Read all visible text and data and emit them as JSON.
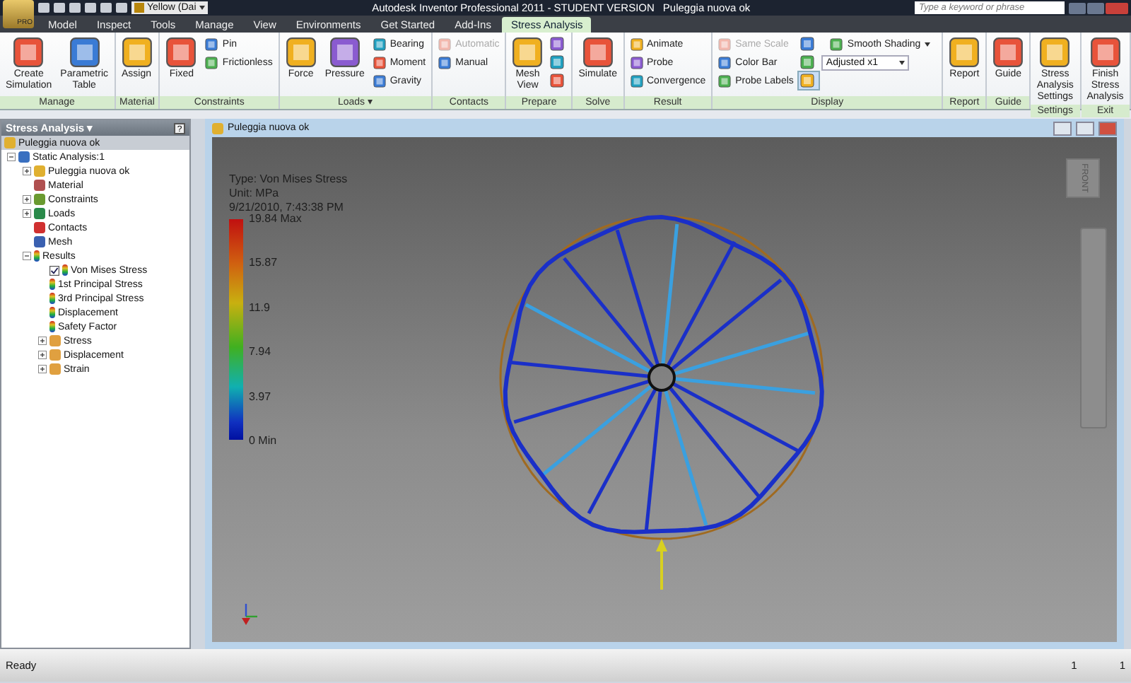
{
  "title_bar": {
    "app_label": "PRO",
    "style_dropdown": "Yellow (Dai",
    "title": "Autodesk Inventor Professional 2011 - STUDENT VERSION",
    "document": "Puleggia nuova ok",
    "search": {
      "placeholder": "Type a keyword or phrase"
    }
  },
  "tabs": [
    {
      "label": "Model",
      "selected": false
    },
    {
      "label": "Inspect",
      "selected": false
    },
    {
      "label": "Tools",
      "selected": false
    },
    {
      "label": "Manage",
      "selected": false
    },
    {
      "label": "View",
      "selected": false
    },
    {
      "label": "Environments",
      "selected": false
    },
    {
      "label": "Get Started",
      "selected": false
    },
    {
      "label": "Add-Ins",
      "selected": false
    },
    {
      "label": "Stress Analysis",
      "selected": true
    }
  ],
  "ribbon": {
    "panels": [
      {
        "title": "Manage",
        "columns": [
          [
            {
              "kind": "large",
              "label": "Create Simulation",
              "disabled": false
            }
          ],
          [
            {
              "kind": "large",
              "label": "Parametric Table",
              "disabled": false
            }
          ]
        ]
      },
      {
        "title": "Material",
        "columns": [
          [
            {
              "kind": "large",
              "label": "Assign",
              "disabled": false
            }
          ]
        ]
      },
      {
        "title": "Constraints",
        "columns": [
          [
            {
              "kind": "large",
              "label": "Fixed",
              "disabled": false
            }
          ],
          [
            {
              "kind": "small",
              "label": "Pin",
              "disabled": false
            },
            {
              "kind": "small",
              "label": "Frictionless",
              "disabled": false
            }
          ]
        ]
      },
      {
        "title": "Loads ▾",
        "columns": [
          [
            {
              "kind": "large",
              "label": "Force",
              "disabled": false
            }
          ],
          [
            {
              "kind": "large",
              "label": "Pressure",
              "disabled": false
            }
          ],
          [
            {
              "kind": "small",
              "label": "Bearing",
              "disabled": false
            },
            {
              "kind": "small",
              "label": "Moment",
              "disabled": false
            },
            {
              "kind": "small",
              "label": "Gravity",
              "disabled": false
            }
          ]
        ]
      },
      {
        "title": "Contacts",
        "columns": [
          [
            {
              "kind": "small",
              "label": "Automatic",
              "disabled": true
            },
            {
              "kind": "small",
              "label": "Manual",
              "disabled": false
            }
          ]
        ]
      },
      {
        "title": "Prepare",
        "columns": [
          [
            {
              "kind": "large",
              "label": "Mesh View",
              "disabled": false
            }
          ],
          [
            {
              "kind": "icon",
              "selected": false
            },
            {
              "kind": "icon",
              "selected": false
            },
            {
              "kind": "icon",
              "selected": false
            }
          ]
        ]
      },
      {
        "title": "Solve",
        "columns": [
          [
            {
              "kind": "large",
              "label": "Simulate",
              "disabled": false
            }
          ]
        ]
      },
      {
        "title": "Result",
        "columns": [
          [
            {
              "kind": "small",
              "label": "Animate",
              "disabled": false
            },
            {
              "kind": "small",
              "label": "Probe",
              "disabled": false
            },
            {
              "kind": "small",
              "label": "Convergence",
              "disabled": false
            }
          ]
        ]
      },
      {
        "title": "Display",
        "columns": [
          [
            {
              "kind": "small",
              "label": "Same Scale",
              "disabled": true
            },
            {
              "kind": "small",
              "label": "Color Bar",
              "disabled": false
            },
            {
              "kind": "small",
              "label": "Probe Labels",
              "disabled": false
            }
          ],
          [
            {
              "kind": "icon",
              "selected": false
            },
            {
              "kind": "icon",
              "selected": false
            },
            {
              "kind": "icon",
              "selected": true
            }
          ],
          [
            {
              "kind": "dropdown",
              "label": "Smooth Shading",
              "disabled": false
            },
            {
              "kind": "combo",
              "label": "Adjusted x1",
              "disabled": false
            }
          ]
        ]
      },
      {
        "title": "Report",
        "columns": [
          [
            {
              "kind": "large",
              "label": "Report",
              "disabled": false
            }
          ]
        ]
      },
      {
        "title": "Guide",
        "columns": [
          [
            {
              "kind": "large",
              "label": "Guide",
              "disabled": false
            }
          ]
        ]
      },
      {
        "title": "Settings",
        "columns": [
          [
            {
              "kind": "large",
              "label": "Stress Analysis Settings",
              "disabled": false
            }
          ]
        ]
      },
      {
        "title": "Exit",
        "columns": [
          [
            {
              "kind": "large",
              "label": "Finish Stress Analysis",
              "disabled": false
            }
          ]
        ]
      }
    ]
  },
  "browser": {
    "title": "Stress Analysis ▾",
    "help": "?",
    "document": "Puleggia nuova ok",
    "tree": [
      {
        "label": "Static Analysis:1",
        "kind": "analysis",
        "expanded": true,
        "children": [
          {
            "label": "Puleggia nuova ok",
            "kind": "part",
            "expanded": false
          },
          {
            "label": "Material",
            "kind": "material"
          },
          {
            "label": "Constraints",
            "kind": "constraints",
            "expanded": false
          },
          {
            "label": "Loads",
            "kind": "loads",
            "expanded": false
          },
          {
            "label": "Contacts",
            "kind": "contacts"
          },
          {
            "label": "Mesh",
            "kind": "mesh"
          },
          {
            "label": "Results",
            "kind": "result",
            "expanded": true,
            "children": [
              {
                "label": "Von Mises Stress",
                "kind": "result",
                "checked": true
              },
              {
                "label": "1st Principal Stress",
                "kind": "result"
              },
              {
                "label": "3rd Principal Stress",
                "kind": "result"
              },
              {
                "label": "Displacement",
                "kind": "result"
              },
              {
                "label": "Safety Factor",
                "kind": "result"
              },
              {
                "label": "Stress",
                "kind": "folder",
                "expanded": false
              },
              {
                "label": "Displacement",
                "kind": "folder",
                "expanded": false
              },
              {
                "label": "Strain",
                "kind": "folder",
                "expanded": false
              }
            ]
          }
        ]
      }
    ]
  },
  "graphics_window": {
    "title": "Puleggia nuova ok",
    "legend": {
      "type": "Type: Von Mises Stress",
      "unit": "Unit: MPa",
      "timestamp": "9/21/2010, 7:43:38 PM",
      "ticks": [
        "19.84 Max",
        "15.87",
        "11.9",
        "7.94",
        "3.97",
        "0 Min"
      ]
    },
    "viewcube_label": "FRONT"
  },
  "status_bar": {
    "message": "Ready",
    "fields": [
      "1",
      "1"
    ]
  }
}
